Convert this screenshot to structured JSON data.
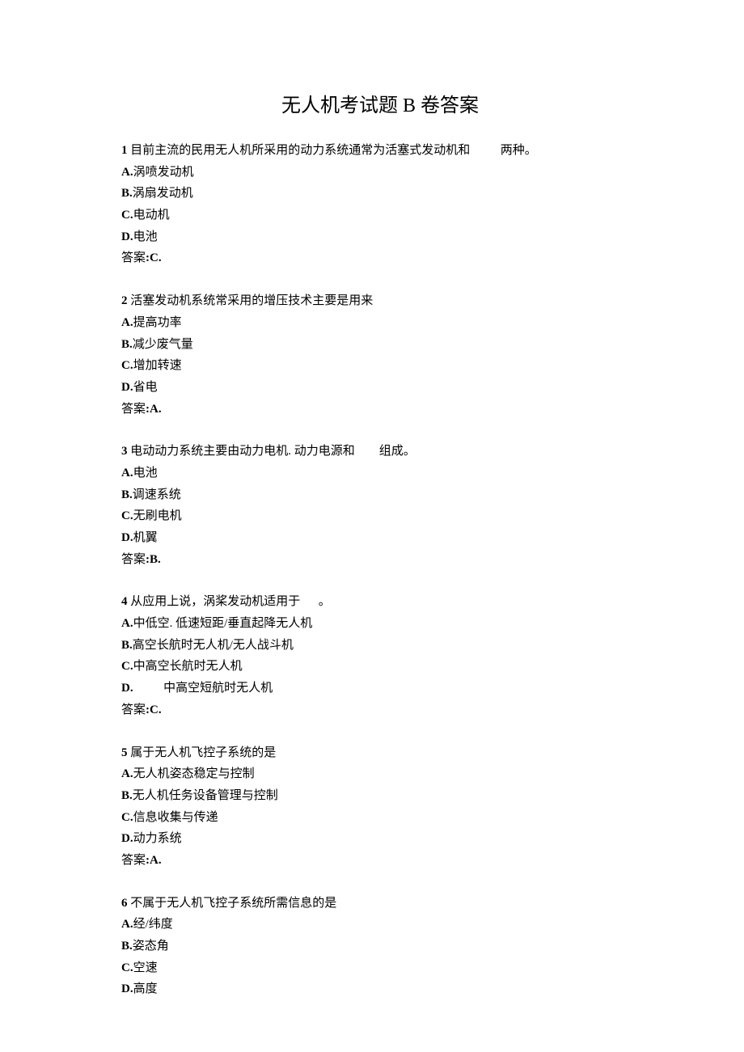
{
  "title": "无人机考试题 B 卷答案",
  "questions": [
    {
      "num": "1",
      "stem_parts": [
        "目前主流的民用无人机所采用的动力系统通常为活塞式发动机和",
        "两种。"
      ],
      "gap": "          ",
      "options": [
        {
          "label": "A.",
          "text": "涡喷发动机"
        },
        {
          "label": "B.",
          "text": "涡扇发动机"
        },
        {
          "label": "C.",
          "text": "电动机"
        },
        {
          "label": "D.",
          "text": "电池"
        }
      ],
      "answer_label": "答案",
      "answer": ":C."
    },
    {
      "num": "2",
      "stem_parts": [
        "活塞发动机系统常采用的增压技术主要是用来",
        ""
      ],
      "gap": "",
      "options": [
        {
          "label": "A.",
          "text": "提高功率"
        },
        {
          "label": "B.",
          "text": "减少废气量"
        },
        {
          "label": "C.",
          "text": "增加转速"
        },
        {
          "label": "D.",
          "text": "省电"
        }
      ],
      "answer_label": "答案",
      "answer": ":A."
    },
    {
      "num": "3",
      "stem_parts": [
        "电动动力系统主要由动力电机. 动力电源和",
        "组成。"
      ],
      "gap": "        ",
      "options": [
        {
          "label": "A.",
          "text": "电池"
        },
        {
          "label": "B.",
          "text": "调速系统"
        },
        {
          "label": "C.",
          "text": "无刷电机"
        },
        {
          "label": "D.",
          "text": "机翼"
        }
      ],
      "answer_label": "答案",
      "answer": ":B."
    },
    {
      "num": "4",
      "stem_parts": [
        "从应用上说，涡桨发动机适用于",
        "。"
      ],
      "gap": "      ",
      "options": [
        {
          "label": "A.",
          "text": "中低空. 低速短距/垂直起降无人机"
        },
        {
          "label": "B.",
          "text": "高空长航时无人机/无人战斗机"
        },
        {
          "label": "C.",
          "text": "中高空长航时无人机"
        },
        {
          "label": "D.",
          "text": "          中高空短航时无人机"
        }
      ],
      "answer_label": "答案",
      "answer": ":C."
    },
    {
      "num": "5",
      "stem_parts": [
        "属于无人机飞控子系统的是",
        ""
      ],
      "gap": "",
      "options": [
        {
          "label": "A.",
          "text": "无人机姿态稳定与控制"
        },
        {
          "label": "B.",
          "text": "无人机任务设备管理与控制"
        },
        {
          "label": "C.",
          "text": "信息收集与传递"
        },
        {
          "label": "D.",
          "text": "动力系统"
        }
      ],
      "answer_label": "答案",
      "answer": ":A."
    },
    {
      "num": "6",
      "stem_parts": [
        "不属于无人机飞控子系统所需信息的是",
        ""
      ],
      "gap": "",
      "options": [
        {
          "label": "A.",
          "text": "经/纬度"
        },
        {
          "label": "B.",
          "text": "姿态角"
        },
        {
          "label": "C.",
          "text": "空速"
        },
        {
          "label": "D.",
          "text": "高度"
        }
      ],
      "answer_label": null,
      "answer": null
    }
  ]
}
